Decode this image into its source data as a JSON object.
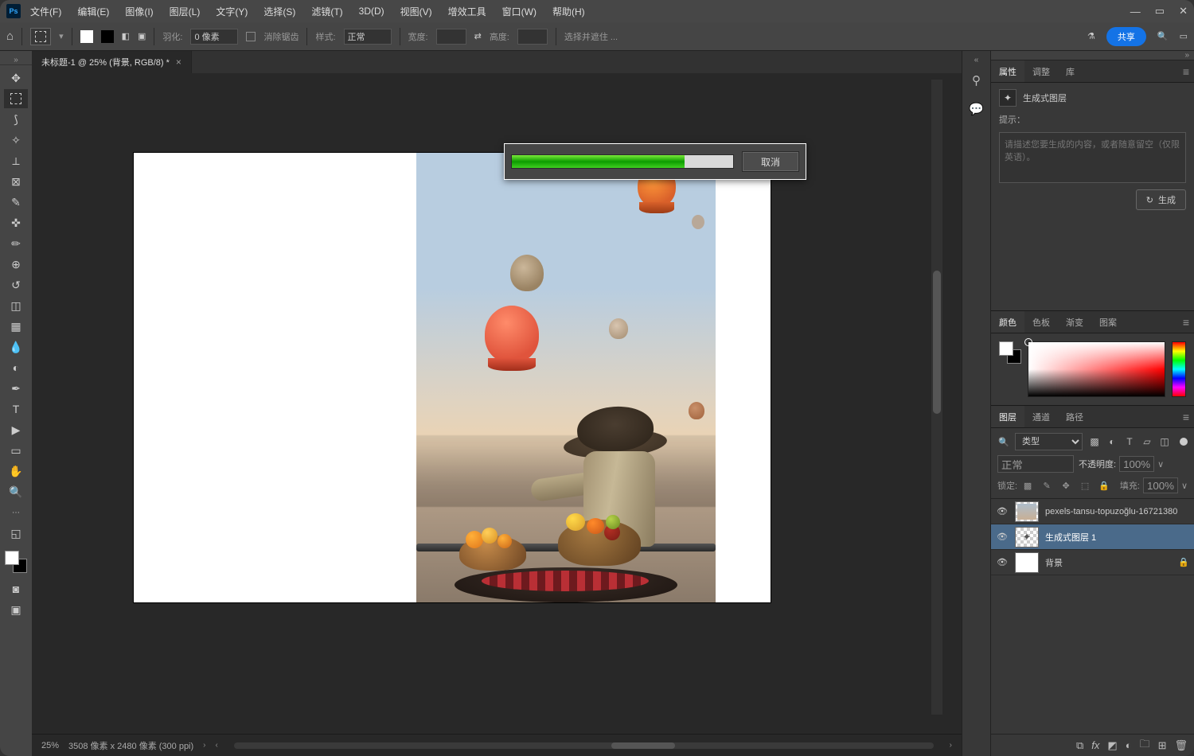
{
  "menu": {
    "file": "文件(F)",
    "edit": "编辑(E)",
    "image": "图像(I)",
    "layer": "图层(L)",
    "type": "文字(Y)",
    "select": "选择(S)",
    "filter": "滤镜(T)",
    "threeD": "3D(D)",
    "view": "视图(V)",
    "plugins": "增效工具",
    "window": "窗口(W)",
    "help": "帮助(H)"
  },
  "optbar": {
    "feather": "羽化:",
    "feather_val": "0 像素",
    "antialias": "消除锯齿",
    "style": "样式:",
    "style_val": "正常",
    "width": "宽度:",
    "height": "高度:",
    "mask": "选择并遮住 ...",
    "share": "共享"
  },
  "doc_tab": "未标题-1 @ 25% (背景, RGB/8) *",
  "progress": {
    "cancel": "取消"
  },
  "status": {
    "zoom": "25%",
    "info": "3508 像素 x 2480 像素 (300 ppi)"
  },
  "props": {
    "tab_props": "属性",
    "tab_adjust": "调整",
    "tab_lib": "库",
    "gen_layer": "生成式图层",
    "hint": "提示：",
    "placeholder": "请描述您要生成的内容，或者随意留空（仅限英语）。",
    "generate": "生成"
  },
  "color": {
    "tab_color": "颜色",
    "tab_swatch": "色板",
    "tab_grad": "渐变",
    "tab_pattern": "图案"
  },
  "layers": {
    "tab_layers": "图层",
    "tab_channels": "通道",
    "tab_paths": "路径",
    "kind": "类型",
    "blend": "正常",
    "opacity_lbl": "不透明度:",
    "opacity_val": "100%",
    "lock": "锁定:",
    "fill_lbl": "填充:",
    "fill_val": "100%",
    "l1": "pexels-tansu-topuzoğlu-16721380",
    "l2": "生成式图层 1",
    "l3": "背景"
  }
}
